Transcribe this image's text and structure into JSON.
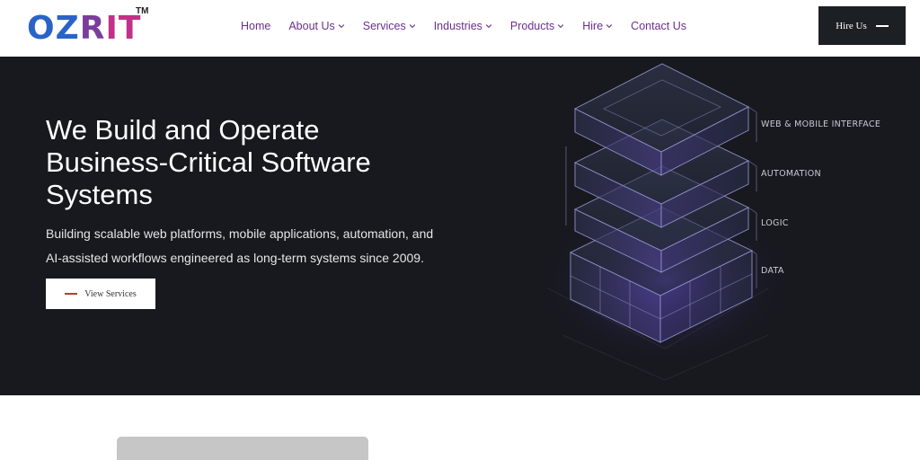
{
  "brand": {
    "logo_letters": [
      "O",
      "Z",
      "R",
      "I",
      "T"
    ],
    "trademark": "TM",
    "colors": {
      "blue": "#2a63c8",
      "purple": "#7a3d9e",
      "pink": "#c2308a"
    }
  },
  "nav": {
    "items": [
      {
        "label": "Home",
        "dropdown": false
      },
      {
        "label": "About Us",
        "dropdown": true
      },
      {
        "label": "Services",
        "dropdown": true
      },
      {
        "label": "Industries",
        "dropdown": true
      },
      {
        "label": "Products",
        "dropdown": true
      },
      {
        "label": "Hire",
        "dropdown": true
      },
      {
        "label": "Contact Us",
        "dropdown": false
      }
    ],
    "hire_button": "Hire Us"
  },
  "hero": {
    "title_lines": [
      "We Build and Operate",
      "Business-Critical Software",
      "Systems"
    ],
    "subtitle_lines": [
      "Building scalable web platforms, mobile applications, automation, and",
      "AI-assisted workflows engineered as long-term systems since 2009."
    ],
    "cta": "View Services",
    "layers": [
      "WEB & MOBILE INTERFACE",
      "AUTOMATION",
      "LOGIC",
      "DATA"
    ],
    "colors": {
      "background": "#17191f",
      "accent": "#c0392b",
      "glow": "#7b5cff"
    }
  }
}
